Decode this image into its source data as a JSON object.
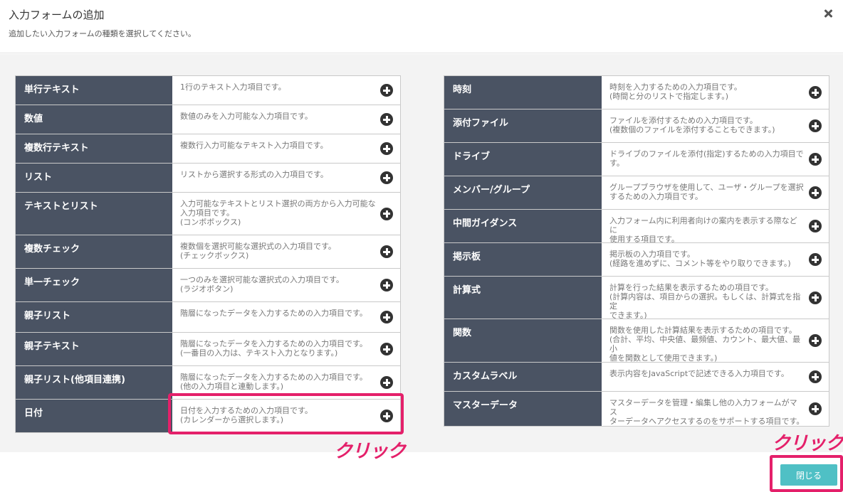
{
  "header": {
    "title": "入力フォームの追加",
    "subtitle": "追加したい入力フォームの種類を選択してください。"
  },
  "left_types": [
    {
      "name": "単行テキスト",
      "desc": "1行のテキスト入力項目です。"
    },
    {
      "name": "数値",
      "desc": "数値のみを入力可能な入力項目です。"
    },
    {
      "name": "複数行テキスト",
      "desc": "複数行入力可能なテキスト入力項目です。"
    },
    {
      "name": "リスト",
      "desc": "リストから選択する形式の入力項目です。"
    },
    {
      "name": "テキストとリスト",
      "desc": "入力可能なテキストとリスト選択の両方から入力可能な\n入力項目です。\n(コンボボックス)"
    },
    {
      "name": "複数チェック",
      "desc": "複数個を選択可能な選択式の入力項目です。\n(チェックボックス)"
    },
    {
      "name": "単一チェック",
      "desc": "一つのみを選択可能な選択式の入力項目です。\n(ラジオボタン)"
    },
    {
      "name": "親子リスト",
      "desc": "階層になったデータを入力するための入力項目です。"
    },
    {
      "name": "親子テキスト",
      "desc": "階層になったデータを入力するための入力項目です。\n(一番目の入力は、テキスト入力となります。)"
    },
    {
      "name": "親子リスト(他項目連携)",
      "desc": "階層になったデータを入力するための入力項目です。\n(他の入力項目と連動します。)"
    },
    {
      "name": "日付",
      "desc": "日付を入力するための入力項目です。\n(カレンダーから選択します。)"
    }
  ],
  "right_types": [
    {
      "name": "時刻",
      "desc": "時刻を入力するための入力項目です。\n(時間と分のリストで指定します。)"
    },
    {
      "name": "添付ファイル",
      "desc": "ファイルを添付するための入力項目です。\n(複数個のファイルを添付することもできます。)"
    },
    {
      "name": "ドライブ",
      "desc": "ドライブのファイルを添付(指定)するための入力項目で\nす。"
    },
    {
      "name": "メンバー/グループ",
      "desc": "グループブラウザを使用して、ユーザ・グループを選択\nするための入力項目です。"
    },
    {
      "name": "中間ガイダンス",
      "desc": "入力フォーム内に利用者向けの案内を表示する際などに\n使用する項目です。"
    },
    {
      "name": "掲示板",
      "desc": "掲示板の入力項目です。\n(経路を進めずに、コメント等をやり取りできます。)"
    },
    {
      "name": "計算式",
      "desc": "計算を行った結果を表示するための項目です。\n(計算内容は、項目からの選択。もしくは、計算式を指定\nできます。)"
    },
    {
      "name": "関数",
      "desc": "関数を使用した計算結果を表示するための項目です。\n(合計、平均、中央値、最頻値、カウント、最大値、最小\n値を関数として使用できます。)"
    },
    {
      "name": "カスタムラベル",
      "desc": "表示内容をJavaScriptで記述できる入力項目です。"
    },
    {
      "name": "マスターデータ",
      "desc": "マスターデータを管理・編集し他の入力フォームがマス\nターデータへアクセスするのをサポートする項目です。"
    }
  ],
  "annotations": {
    "click_1": "クリック",
    "click_2": "クリック"
  },
  "footer": {
    "close_label": "閉じる"
  }
}
